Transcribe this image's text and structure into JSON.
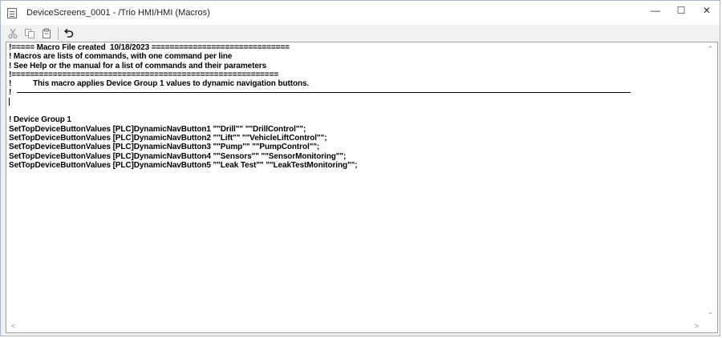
{
  "window": {
    "title": "DeviceScreens_0001 - /Trio HMI/HMI (Macros)",
    "controls": {
      "minimize": "—",
      "maximize": "☐",
      "close": "✕"
    }
  },
  "toolbar": {
    "icons": [
      "cut-icon",
      "copy-icon",
      "paste-icon",
      "undo-icon"
    ]
  },
  "editor": {
    "lines": [
      "!===== Macro File created  10/18/2023 ==============================",
      "! Macros are lists of commands, with one command per line",
      "! See Help or the manual for a list of commands and their parameters",
      "!==========================================================",
      "!          This macro applies Device Group 1 values to dynamic navigation buttons.",
      "! ",
      "",
      "",
      "! Device Group 1",
      "SetTopDeviceButtonValues [PLC]DynamicNavButton1 \"\"Drill\"\" \"\"DrillControl\"\";",
      "SetTopDeviceButtonValues [PLC]DynamicNavButton2 \"\"Lift\"\" \"\"VehicleLiftControl\"\";",
      "SetTopDeviceButtonValues [PLC]DynamicNavButton3 \"\"Pump\"\" \"\"PumpControl\"\";",
      "SetTopDeviceButtonValues [PLC]DynamicNavButton4 \"\"Sensors\"\" \"\"SensorMonitoring\"\";",
      "SetTopDeviceButtonValues [PLC]DynamicNavButton5 \"\"Leak Test\"\" \"\"LeakTestMonitoring\"\";"
    ]
  }
}
